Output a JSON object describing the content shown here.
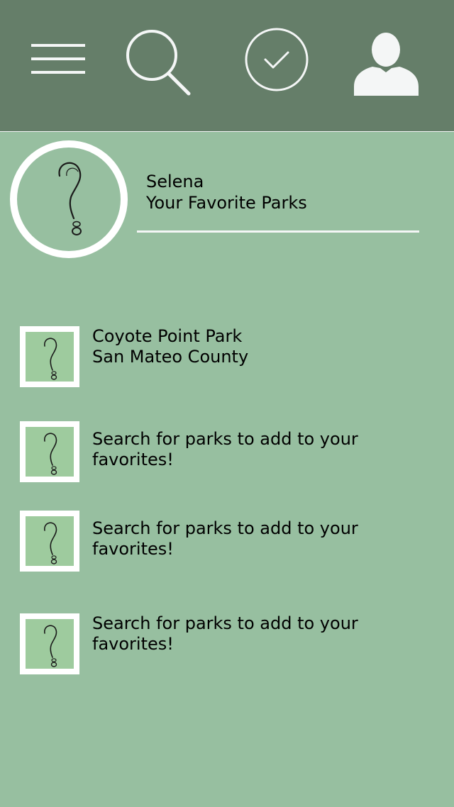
{
  "theme": {
    "header_bg": "#657e69",
    "page_bg": "#97bfa0",
    "thumb_fill": "#9ecb9e",
    "icon_color": "#f4f6f6"
  },
  "header": {
    "icons": [
      "menu-icon",
      "search-icon",
      "check-circle-icon",
      "user-icon"
    ]
  },
  "profile": {
    "photo_icon": "question-mark-icon",
    "name": "Selena",
    "subtitle": "Your Favorite Parks"
  },
  "favorites": [
    {
      "icon": "question-mark-icon",
      "title": "Coyote Point Park",
      "subtitle": "San Mateo County"
    },
    {
      "icon": "question-mark-icon",
      "text": "Search for parks to add to your favorites!"
    },
    {
      "icon": "question-mark-icon",
      "text": "Search for parks to add to your favorites!"
    },
    {
      "icon": "question-mark-icon",
      "text": "Search for parks to add to your favorites!"
    }
  ]
}
